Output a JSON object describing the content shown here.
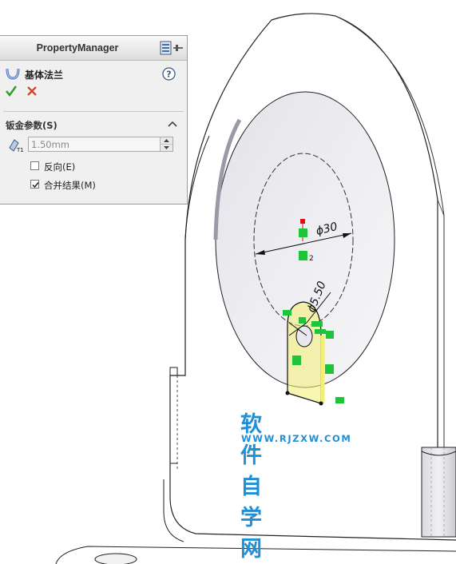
{
  "property_manager": {
    "title": "PropertyManager",
    "feature_name": "基体法兰",
    "group_title": "钣金参数(S)",
    "thickness_value": "1.50mm",
    "reverse_label": "反向(E)",
    "reverse_checked": false,
    "merge_label": "合并结果(M)",
    "merge_checked": true,
    "icons": [
      "pushpin-icon",
      "base-flange-icon",
      "help-icon",
      "ok-check-icon",
      "cancel-x-icon",
      "collapse-icon",
      "thickness-icon"
    ]
  },
  "sketch": {
    "large_circle_dim": "ϕ30",
    "small_circle_dim": "ϕ5.50",
    "relation_marker": "2"
  },
  "watermark": {
    "title": "软件自学网",
    "url": "WWW.RJZXW.COM"
  },
  "colors": {
    "relation_green": "#1fc43a",
    "selection_yellow": "#f3ef70",
    "watermark_blue": "#1f8fd6",
    "ok_green": "#2a9c2a",
    "cancel_red": "#d23a1f"
  }
}
